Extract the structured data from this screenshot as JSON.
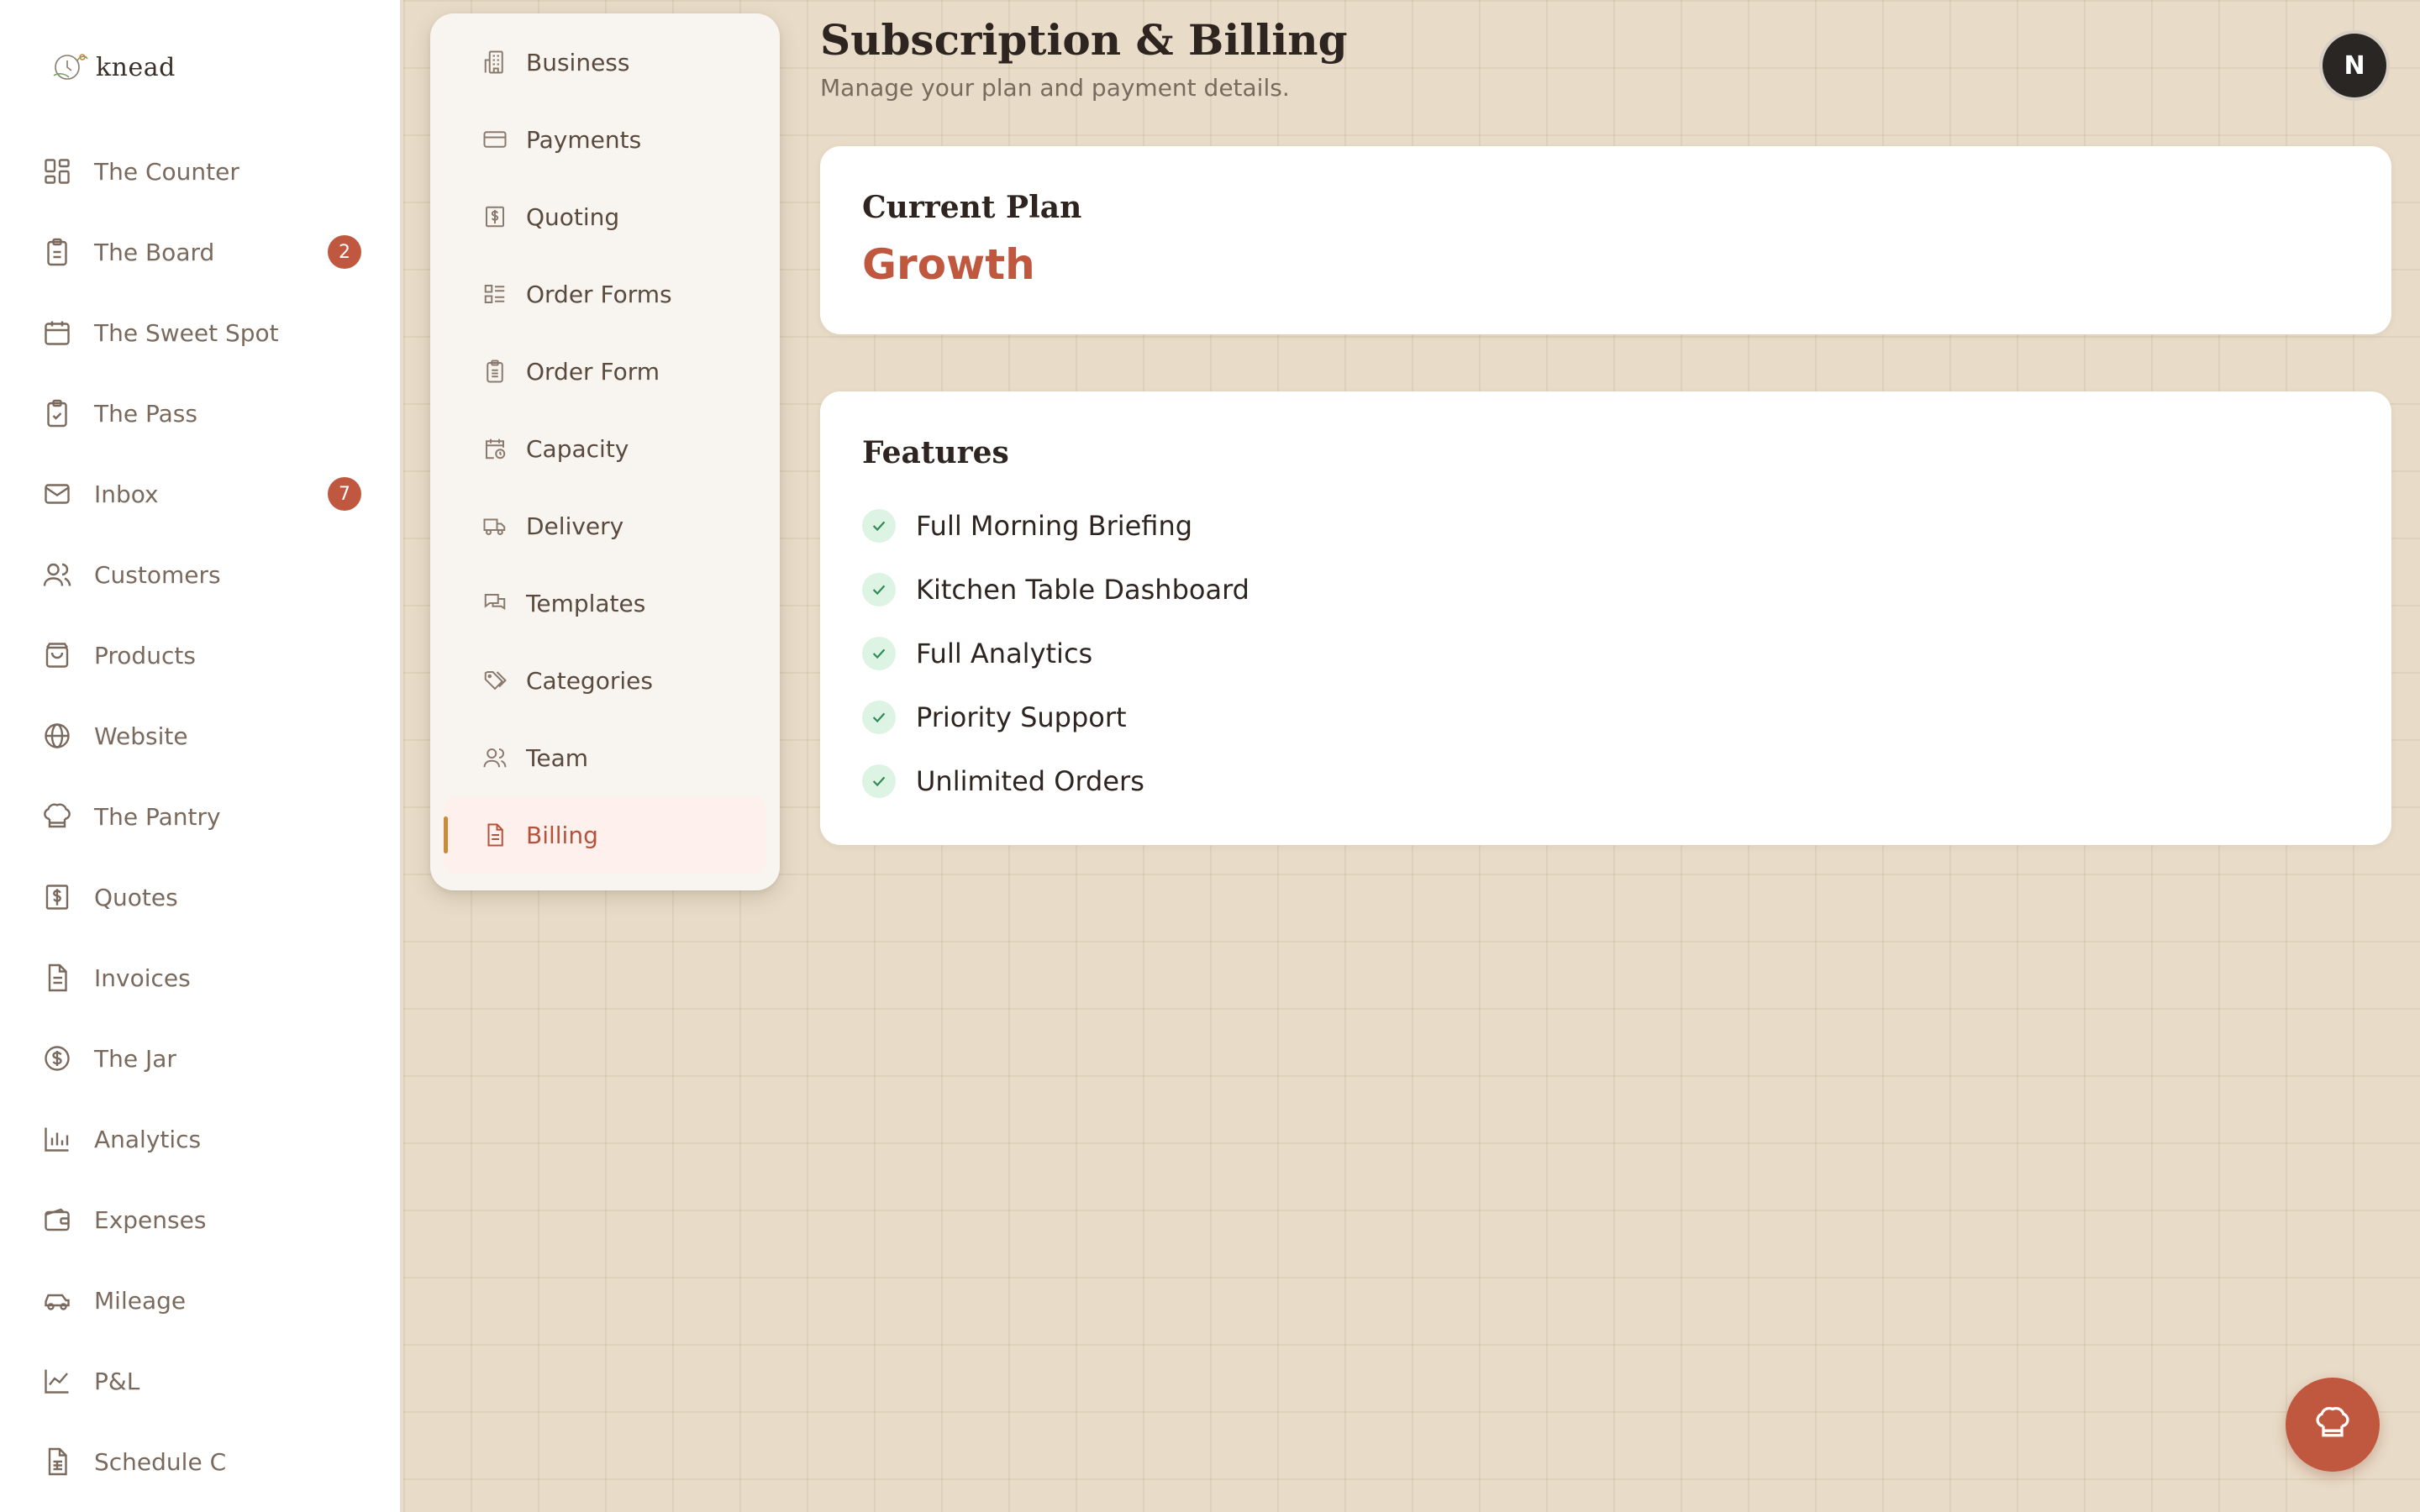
{
  "app": {
    "logo_text": "knead"
  },
  "sidebar": {
    "items": [
      {
        "label": "The Counter",
        "icon": "grid-icon"
      },
      {
        "label": "The Board",
        "icon": "clipboard-icon",
        "badge": "2"
      },
      {
        "label": "The Sweet Spot",
        "icon": "calendar-icon"
      },
      {
        "label": "The Pass",
        "icon": "clipboard-check-icon"
      },
      {
        "label": "Inbox",
        "icon": "mail-icon",
        "badge": "7"
      },
      {
        "label": "Customers",
        "icon": "users-icon"
      },
      {
        "label": "Products",
        "icon": "shopping-bag-icon"
      },
      {
        "label": "Website",
        "icon": "globe-icon"
      },
      {
        "label": "The Pantry",
        "icon": "chef-hat-icon"
      },
      {
        "label": "Quotes",
        "icon": "dollar-receipt-icon"
      },
      {
        "label": "Invoices",
        "icon": "document-icon"
      },
      {
        "label": "The Jar",
        "icon": "dollar-circle-icon"
      },
      {
        "label": "Analytics",
        "icon": "bar-chart-icon"
      },
      {
        "label": "Expenses",
        "icon": "wallet-icon"
      },
      {
        "label": "Mileage",
        "icon": "car-icon"
      },
      {
        "label": "P&L",
        "icon": "line-chart-icon"
      },
      {
        "label": "Schedule C",
        "icon": "spreadsheet-icon"
      }
    ]
  },
  "settings_menu": {
    "items": [
      {
        "label": "Business",
        "icon": "building-icon"
      },
      {
        "label": "Payments",
        "icon": "credit-card-icon"
      },
      {
        "label": "Quoting",
        "icon": "dollar-receipt-icon"
      },
      {
        "label": "Order Forms",
        "icon": "list-icon"
      },
      {
        "label": "Order Form",
        "icon": "clipboard-icon"
      },
      {
        "label": "Capacity",
        "icon": "calendar-clock-icon"
      },
      {
        "label": "Delivery",
        "icon": "truck-icon"
      },
      {
        "label": "Templates",
        "icon": "messages-icon"
      },
      {
        "label": "Categories",
        "icon": "tags-icon"
      },
      {
        "label": "Team",
        "icon": "users-icon"
      },
      {
        "label": "Billing",
        "icon": "document-icon",
        "active": true
      }
    ]
  },
  "header": {
    "title": "Subscription & Billing",
    "subtitle": "Manage your plan and payment details.",
    "avatar_initial": "N"
  },
  "plan_card": {
    "heading": "Current Plan",
    "plan_name": "Growth"
  },
  "features_card": {
    "heading": "Features",
    "features": [
      "Full Morning Briefing",
      "Kitchen Table Dashboard",
      "Full Analytics",
      "Priority Support",
      "Unlimited Orders"
    ]
  },
  "colors": {
    "accent": "#c0583f",
    "background": "#e8dcc8",
    "check_bg": "#ddf3e3",
    "check_fg": "#2f8a55",
    "active_indicator": "#c98a3a"
  },
  "fab": {
    "icon": "chef-hat-icon"
  }
}
